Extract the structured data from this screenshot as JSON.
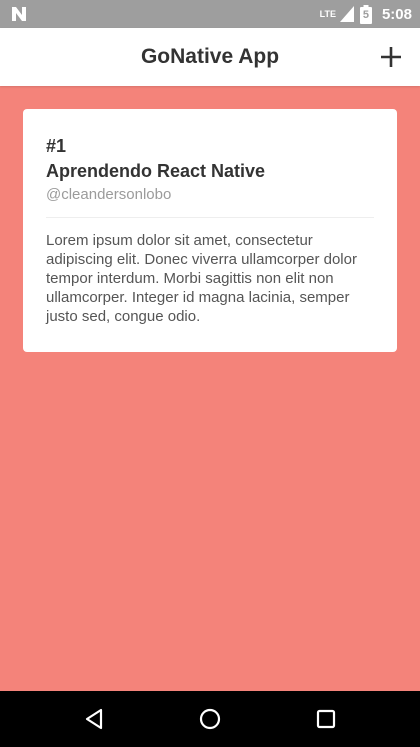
{
  "status_bar": {
    "network_label": "LTE",
    "battery_level": "5",
    "time": "5:08",
    "icons": [
      "notification-n-icon",
      "signal-icon",
      "battery-icon"
    ]
  },
  "header": {
    "title": "GoNative App",
    "add_icon": "plus-icon"
  },
  "repository_card": {
    "number": "#1",
    "title": "Aprendendo React Native",
    "author": "@cleandersonlobo",
    "description": "Lorem ipsum dolor sit amet, consectetur adipiscing elit. Donec viverra ullamcorper dolor tempor interdum. Morbi sagittis non elit non ullamcorper. Integer id magna lacinia, semper justo sed, congue odio."
  },
  "navigation_bar": {
    "icons": [
      "back-icon",
      "home-icon",
      "recents-icon"
    ]
  },
  "colors": {
    "background": "#f4837a",
    "header": "#ffffff",
    "card": "#ffffff",
    "status_bar": "#9e9e9e",
    "nav_bar": "#000000"
  }
}
